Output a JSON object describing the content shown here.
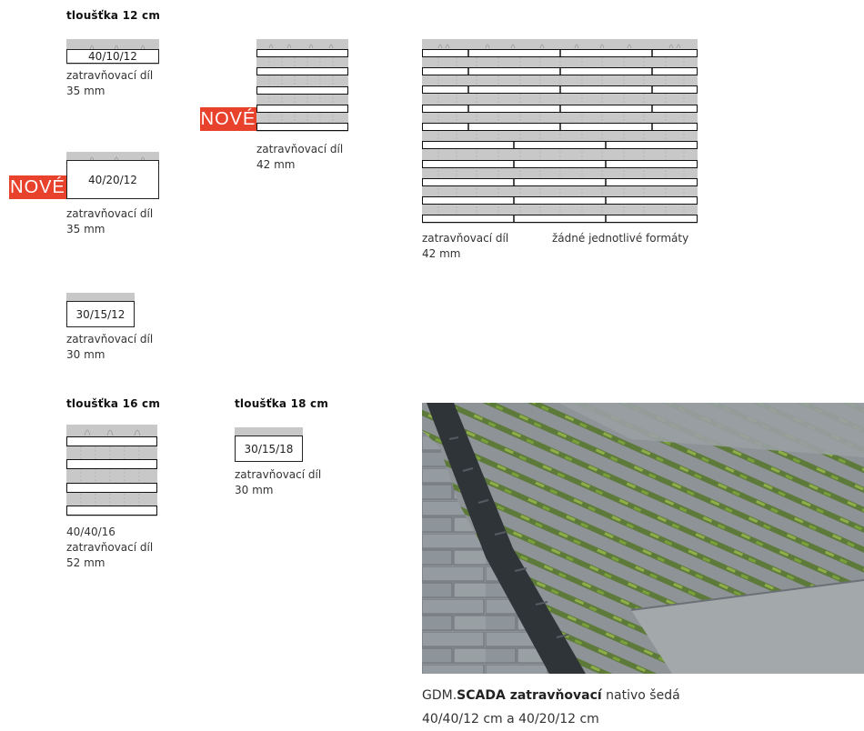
{
  "section_12": {
    "heading": "tloušťka 12 cm",
    "item1": {
      "format": "40/10/12",
      "line1": "zatravňovací díl",
      "line2": "35 mm"
    },
    "item2": {
      "badge": "NOVÉ",
      "format": "40/20/12",
      "line1": "zatravňovací díl",
      "line2": "35 mm"
    },
    "item3": {
      "format": "30/15/12",
      "line1": "zatravňovací díl",
      "line2": "30 mm"
    },
    "item4": {
      "badge": "NOVÉ",
      "line1": "zatravňovací díl",
      "line2": "42 mm"
    },
    "item5": {
      "line1": "zatravňovací díl",
      "line2": "42 mm",
      "note": "žádné jednotlivé formáty"
    }
  },
  "section_16": {
    "heading": "tloušťka 16 cm",
    "item": {
      "format": "40/40/16",
      "line1": "zatravňovací díl",
      "line2": "52 mm"
    }
  },
  "section_18": {
    "heading": "tloušťka 18 cm",
    "item": {
      "format": "30/15/18",
      "line1": "zatravňovací díl",
      "line2": "30 mm"
    }
  },
  "photo": {
    "alt": "zatravňovací dlažba s mřížkovým žlabem",
    "caption_prefix": "GDM.",
    "caption_bold": "SCADA zatravňovací",
    "caption_suffix": "nativo šedá",
    "caption_line2": "40/40/12 cm a 40/20/12 cm"
  },
  "colors": {
    "badge": "#e8412c",
    "tile_gray": "#c8c8c8"
  }
}
